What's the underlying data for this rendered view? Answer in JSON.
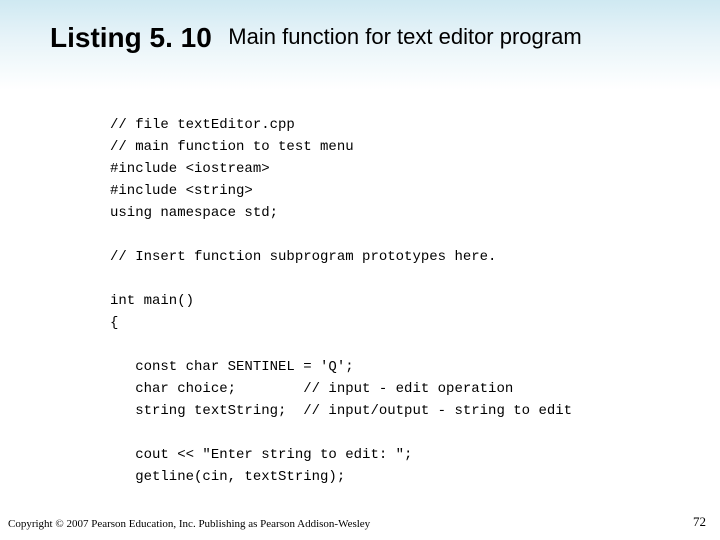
{
  "title": {
    "strong": "Listing 5. 10",
    "sub": "Main function for text editor program"
  },
  "code": "// file textEditor.cpp\n// main function to test menu\n#include <iostream>\n#include <string>\nusing namespace std;\n\n// Insert function subprogram prototypes here.\n\nint main()\n{\n\n   const char SENTINEL = 'Q';\n   char choice;        // input - edit operation\n   string textString;  // input/output - string to edit\n\n   cout << \"Enter string to edit: \";\n   getline(cin, textString);",
  "footer": "Copyright © 2007 Pearson Education, Inc. Publishing as Pearson Addison-Wesley",
  "page": "72"
}
